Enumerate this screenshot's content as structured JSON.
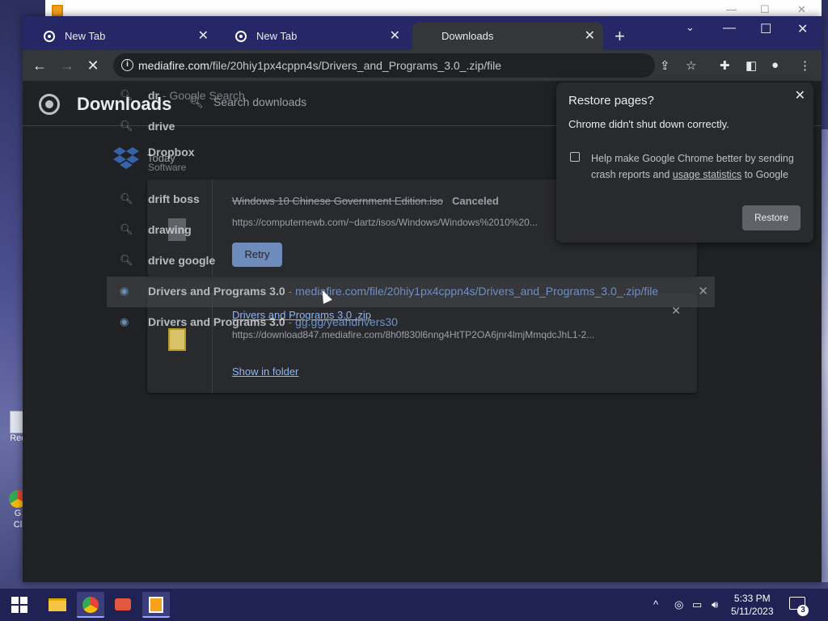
{
  "desktop": {
    "icons": [
      {
        "label": "Rec"
      },
      {
        "label": "G\nCl"
      }
    ]
  },
  "tabs": [
    {
      "label": "New Tab",
      "icon": "chrome-icon"
    },
    {
      "label": "New Tab",
      "icon": "chrome-icon"
    },
    {
      "label": "Downloads",
      "icon": "download-icon"
    }
  ],
  "toolbar": {
    "url_host": "mediafire.com",
    "url_path": "/file/20hiy1px4cppn4s/Drivers_and_Programs_3.0_.zip/file"
  },
  "downloads_page": {
    "title": "Downloads",
    "search_placeholder": "Search downloads",
    "section_label": "Today",
    "items": [
      {
        "name": "Windows 10 Chinese Government Edition.iso",
        "status": "Canceled",
        "url": "https://computernewb.com/~dartz/isos/Windows/Windows%2010%20...",
        "action": "Retry"
      },
      {
        "name": "Drivers and Programs 3.0 .zip",
        "url": "https://download847.mediafire.com/8h0f830l6nng4HtTP2OA6jnr4lmjMmqdcJhL1-2...",
        "action": "Show in folder"
      }
    ]
  },
  "suggestions": [
    {
      "icon": "search-icon",
      "text_bold": "dr",
      "text": " - Google Search"
    },
    {
      "icon": "search-icon",
      "text_bold": "dr",
      "text": "ive"
    },
    {
      "icon": "dropbox-icon",
      "text_bold": "Dr",
      "text": "opbox",
      "sub": "Software"
    },
    {
      "icon": "search-icon",
      "text_bold": "dr",
      "text": "ift boss"
    },
    {
      "icon": "search-icon",
      "text_bold": "dr",
      "text": "awing"
    },
    {
      "icon": "search-icon",
      "text_bold": "dr",
      "text": "ive google"
    },
    {
      "icon": "edge-icon",
      "title": "Drivers and Programs 3.0",
      "url": "mediafire.com/file/20hiy1px4cppn4s/Drivers_and_Programs_3.0_.zip/file"
    },
    {
      "icon": "edge-icon",
      "title": "Drivers and Programs 3.0",
      "url": "gg.gg/yeahdrivers30"
    }
  ],
  "restore_dialog": {
    "title": "Restore pages?",
    "message": "Chrome didn't shut down correctly.",
    "checkbox_text_1": "Help make Google Chrome better by sending crash reports and ",
    "checkbox_link": "usage statistics",
    "checkbox_text_2": " to Google",
    "button": "Restore"
  },
  "taskbar": {
    "time": "5:33 PM",
    "date": "5/11/2023",
    "notification_count": "3"
  }
}
